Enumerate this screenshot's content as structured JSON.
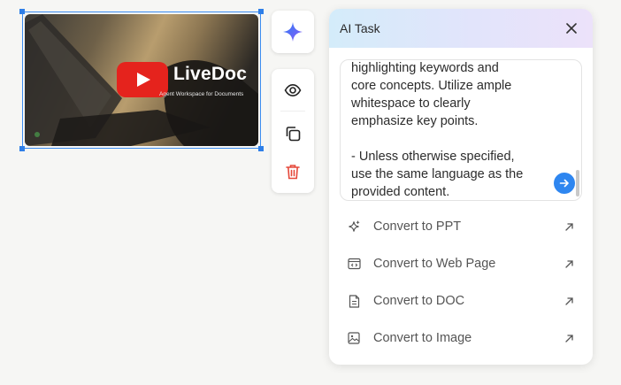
{
  "video": {
    "brand_title": "LiveDoc",
    "brand_subtitle": "Agent Workspace for Documents"
  },
  "toolbar": {
    "icons": [
      "sparkle-icon",
      "eye-icon",
      "copy-icon",
      "trash-icon"
    ]
  },
  "panel": {
    "title": "AI Task",
    "prompt_text": "highlighting keywords and\ncore concepts. Utilize ample\nwhitespace to clearly\nemphasize key points.\n\n- Unless otherwise specified,\nuse the same language as the\nprovided content.",
    "actions": [
      {
        "label": "Convert to PPT",
        "icon": "sparkle-icon"
      },
      {
        "label": "Convert to Web Page",
        "icon": "web-page-icon"
      },
      {
        "label": "Convert to DOC",
        "icon": "document-icon"
      },
      {
        "label": "Convert to Image",
        "icon": "image-icon"
      }
    ]
  },
  "colors": {
    "selection": "#3b8cf0",
    "accent_blue": "#2e86f0",
    "delete_red": "#e5483a",
    "youtube_red": "#e5231d"
  }
}
